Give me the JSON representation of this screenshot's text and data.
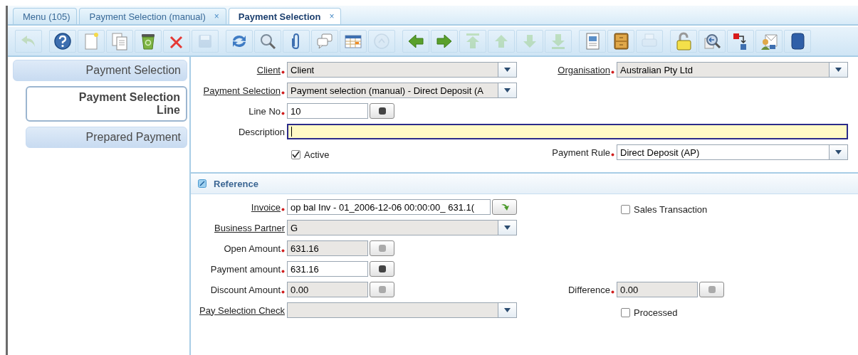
{
  "tabs": [
    {
      "label": "Menu (105)",
      "selected": false
    },
    {
      "label": "Payment Selection (manual)",
      "selected": false,
      "close": "×"
    },
    {
      "label": "Payment Selection",
      "selected": true,
      "close": "×"
    }
  ],
  "toolbar": {
    "groups": [
      [
        {
          "kind": "undo",
          "disabled": true
        }
      ],
      [
        {
          "kind": "help",
          "disabled": false
        },
        {
          "kind": "new",
          "disabled": false
        },
        {
          "kind": "copy",
          "disabled": false
        },
        {
          "kind": "delete",
          "disabled": false
        },
        {
          "kind": "delete_selection",
          "disabled": false
        },
        {
          "kind": "save",
          "disabled": true
        }
      ],
      [
        {
          "kind": "refresh",
          "disabled": false
        },
        {
          "kind": "find",
          "disabled": false
        },
        {
          "kind": "attachment",
          "disabled": false
        },
        {
          "kind": "chat",
          "disabled": false
        },
        {
          "kind": "grid",
          "disabled": false
        },
        {
          "kind": "history",
          "disabled": true
        }
      ],
      [
        {
          "kind": "previous",
          "disabled": false
        },
        {
          "kind": "next",
          "disabled": false
        },
        {
          "kind": "first",
          "disabled": true
        },
        {
          "kind": "up",
          "disabled": true
        },
        {
          "kind": "down",
          "disabled": true
        },
        {
          "kind": "last",
          "disabled": true
        }
      ],
      [
        {
          "kind": "report",
          "disabled": false
        },
        {
          "kind": "archive",
          "disabled": false
        },
        {
          "kind": "print",
          "disabled": true
        }
      ],
      [
        {
          "kind": "lock",
          "disabled": false
        },
        {
          "kind": "zoom_across",
          "disabled": false
        },
        {
          "kind": "workflow",
          "disabled": false
        },
        {
          "kind": "request",
          "disabled": false
        },
        {
          "kind": "customize",
          "disabled": false
        }
      ]
    ]
  },
  "sidebar": {
    "items": [
      {
        "label": "Payment Selection",
        "selected": false,
        "children": [
          {
            "label": "Payment Selection Line",
            "selected": true
          },
          {
            "label": "Prepared Payment",
            "selected": false
          }
        ]
      }
    ]
  },
  "sections": [
    {
      "rows": [
        {
          "left": {
            "kind": "combo",
            "label": "Client",
            "required": true,
            "link": true,
            "disabled": true,
            "value": "Client"
          },
          "right": {
            "kind": "combo",
            "label": "Organisation",
            "required": true,
            "link": true,
            "disabled": true,
            "value": "Australian Pty Ltd"
          }
        },
        {
          "left": {
            "kind": "combo",
            "label": "Payment Selection",
            "required": true,
            "link": true,
            "disabled": true,
            "value": "Payment selection (manual) - Direct Deposit (A"
          }
        },
        {
          "left": {
            "kind": "number",
            "label": "Line No",
            "required": true,
            "link": false,
            "disabled": false,
            "value": "10"
          }
        },
        {
          "full": {
            "kind": "text",
            "label": "Description",
            "required": false,
            "link": false,
            "disabled": false,
            "focused": true
          }
        },
        {
          "left": {
            "kind": "checkbox",
            "label": "Active",
            "checked": true
          },
          "right": {
            "kind": "combo",
            "label": "Payment Rule",
            "required": true,
            "link": false,
            "disabled": false,
            "value": "Direct Deposit (AP)"
          }
        }
      ]
    },
    {
      "title": "Reference",
      "expanded": true,
      "rows": [
        {
          "left": {
            "kind": "search",
            "label": "Invoice",
            "required": true,
            "link": true,
            "disabled": false,
            "value": "op bal Inv - 01_2006-12-06 00:00:00_  631.1("
          },
          "right": {
            "kind": "checkbox",
            "label": "Sales Transaction",
            "checked": false
          }
        },
        {
          "left": {
            "kind": "combo",
            "label": "Business Partner",
            "required": false,
            "link": true,
            "disabled": true,
            "value": "G"
          }
        },
        {
          "left": {
            "kind": "number",
            "label": "Open Amount",
            "required": true,
            "link": false,
            "disabled": true,
            "value": "631.16"
          }
        },
        {
          "left": {
            "kind": "number",
            "label": "Payment amount",
            "required": true,
            "link": false,
            "disabled": false,
            "value": "631.16"
          }
        },
        {
          "left": {
            "kind": "number",
            "label": "Discount Amount",
            "required": true,
            "link": false,
            "disabled": true,
            "value": "0.00"
          },
          "right": {
            "kind": "number",
            "label": "Difference",
            "required": true,
            "link": false,
            "disabled": true,
            "value": "0.00"
          }
        },
        {
          "left": {
            "kind": "combo",
            "label": "Pay Selection Check",
            "required": false,
            "link": true,
            "disabled": true
          },
          "right": {
            "kind": "checkbox",
            "label": "Processed",
            "checked": false
          }
        }
      ]
    }
  ]
}
